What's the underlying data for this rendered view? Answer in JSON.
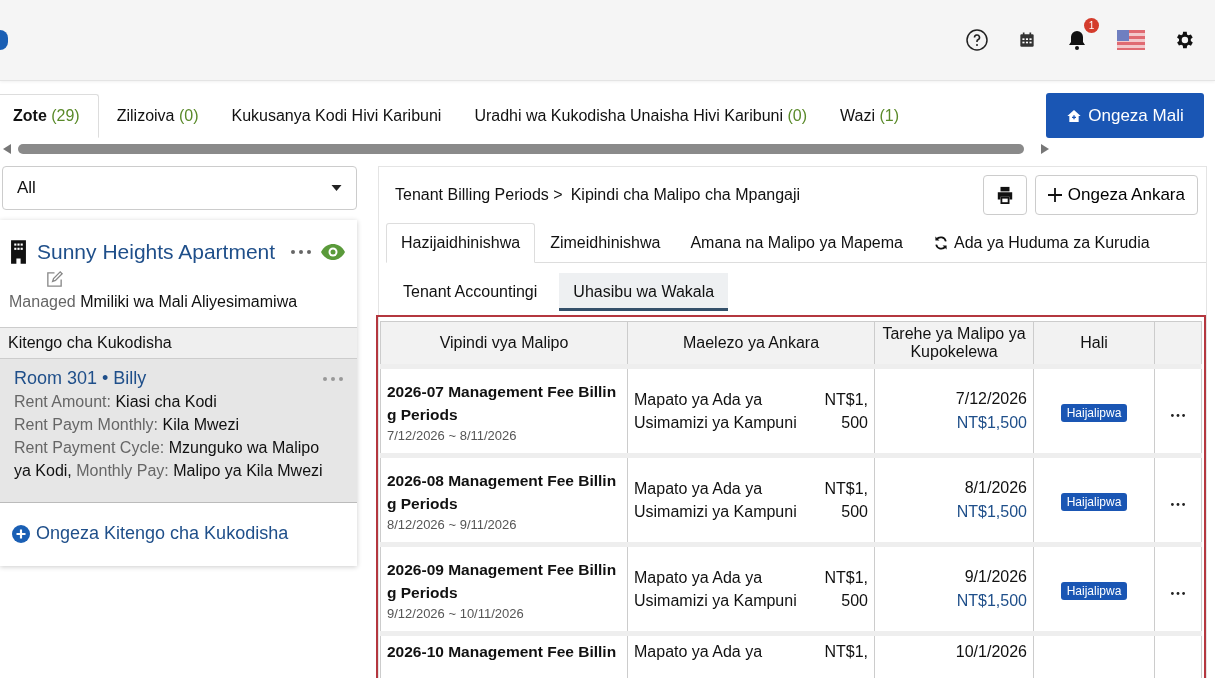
{
  "header": {
    "notification_count": "1"
  },
  "property_tabs": [
    {
      "label": "Zote",
      "count": "(29)",
      "selected": true
    },
    {
      "label": "Zilizoiva",
      "count": "(0)",
      "selected": false
    },
    {
      "label": "Kukusanya Kodi Hivi Karibuni",
      "selected": false
    },
    {
      "label": "Uradhi wa Kukodisha Unaisha Hivi Karibuni",
      "count": "(0)",
      "selected": false
    },
    {
      "label": "Wazi",
      "count": "(1)",
      "selected": false
    }
  ],
  "add_property_button": "Ongeza Mali",
  "filter_select": {
    "value": "All"
  },
  "property": {
    "name": "Sunny Heights Apartment",
    "managed_label": "Managed",
    "managed_value": "Mmiliki wa Mali Aliyesimamiwa",
    "units_header": "Kitengo cha Kukodisha",
    "unit": {
      "title": "Room 301 • Billy",
      "lines": [
        [
          {
            "label": "Rent Amount:",
            "value": "Kiasi cha Kodi"
          }
        ],
        [
          {
            "label": "Rent Paym Monthly:",
            "value": "Kila Mwezi"
          }
        ],
        [
          {
            "label": "Rent Payment Cycle:",
            "value": "Mzunguko wa Malipo ya Kodi,"
          },
          {
            "label": "Monthly Pay:",
            "value": "Malipo ya Kila Mwezi"
          }
        ]
      ]
    },
    "add_unit_link": "Ongeza Kitengo cha Kukodisha"
  },
  "breadcrumb": {
    "parent": "Tenant Billing Periods >",
    "current": "Kipindi cha Malipo cha Mpangaji"
  },
  "add_invoice_button": "Ongeza Ankara",
  "tabs": [
    {
      "label": "Hazijaidhinishwa",
      "selected": true,
      "kind": "plain"
    },
    {
      "label": "Zimeidhinishwa",
      "selected": false,
      "kind": "plain"
    },
    {
      "label": "Amana na Malipo ya Mapema",
      "selected": false,
      "kind": "plain"
    },
    {
      "label": "Ada ya Huduma za Kurudia",
      "selected": false,
      "kind": "recurring"
    }
  ],
  "subtabs": [
    {
      "label": "Tenant Accountingi",
      "selected": false
    },
    {
      "label": "Uhasibu wa Wakala",
      "selected": true
    }
  ],
  "table": {
    "columns": [
      "Vipindi vya Malipo",
      "Maelezo ya Ankara",
      "Tarehe ya Malipo ya Kupokelewa",
      "Hali"
    ],
    "rows": [
      {
        "title": "2026-07 Management Fee Billing Periods",
        "period": "7/12/2026 ~ 8/11/2026",
        "description": "Mapato ya Ada ya Usimamizi ya Kampuni",
        "amount": "NT$1,500",
        "due_date": "7/12/2026",
        "due_amount": "NT$1,500",
        "status": "Haijalipwa"
      },
      {
        "title": "2026-08 Management Fee Billing Periods",
        "period": "8/12/2026 ~ 9/11/2026",
        "description": "Mapato ya Ada ya Usimamizi ya Kampuni",
        "amount": "NT$1,500",
        "due_date": "8/1/2026",
        "due_amount": "NT$1,500",
        "status": "Haijalipwa"
      },
      {
        "title": "2026-09 Management Fee Billing Periods",
        "period": "9/12/2026 ~ 10/11/2026",
        "description": "Mapato ya Ada ya Usimamizi ya Kampuni",
        "amount": "NT$1,500",
        "due_date": "9/1/2026",
        "due_amount": "NT$1,500",
        "status": "Haijalipwa"
      },
      {
        "title": "2026-10 Management Fee Billin",
        "description": "Mapato ya Ada ya",
        "amount": "NT$1,",
        "due_date": "10/1/2026"
      }
    ]
  }
}
